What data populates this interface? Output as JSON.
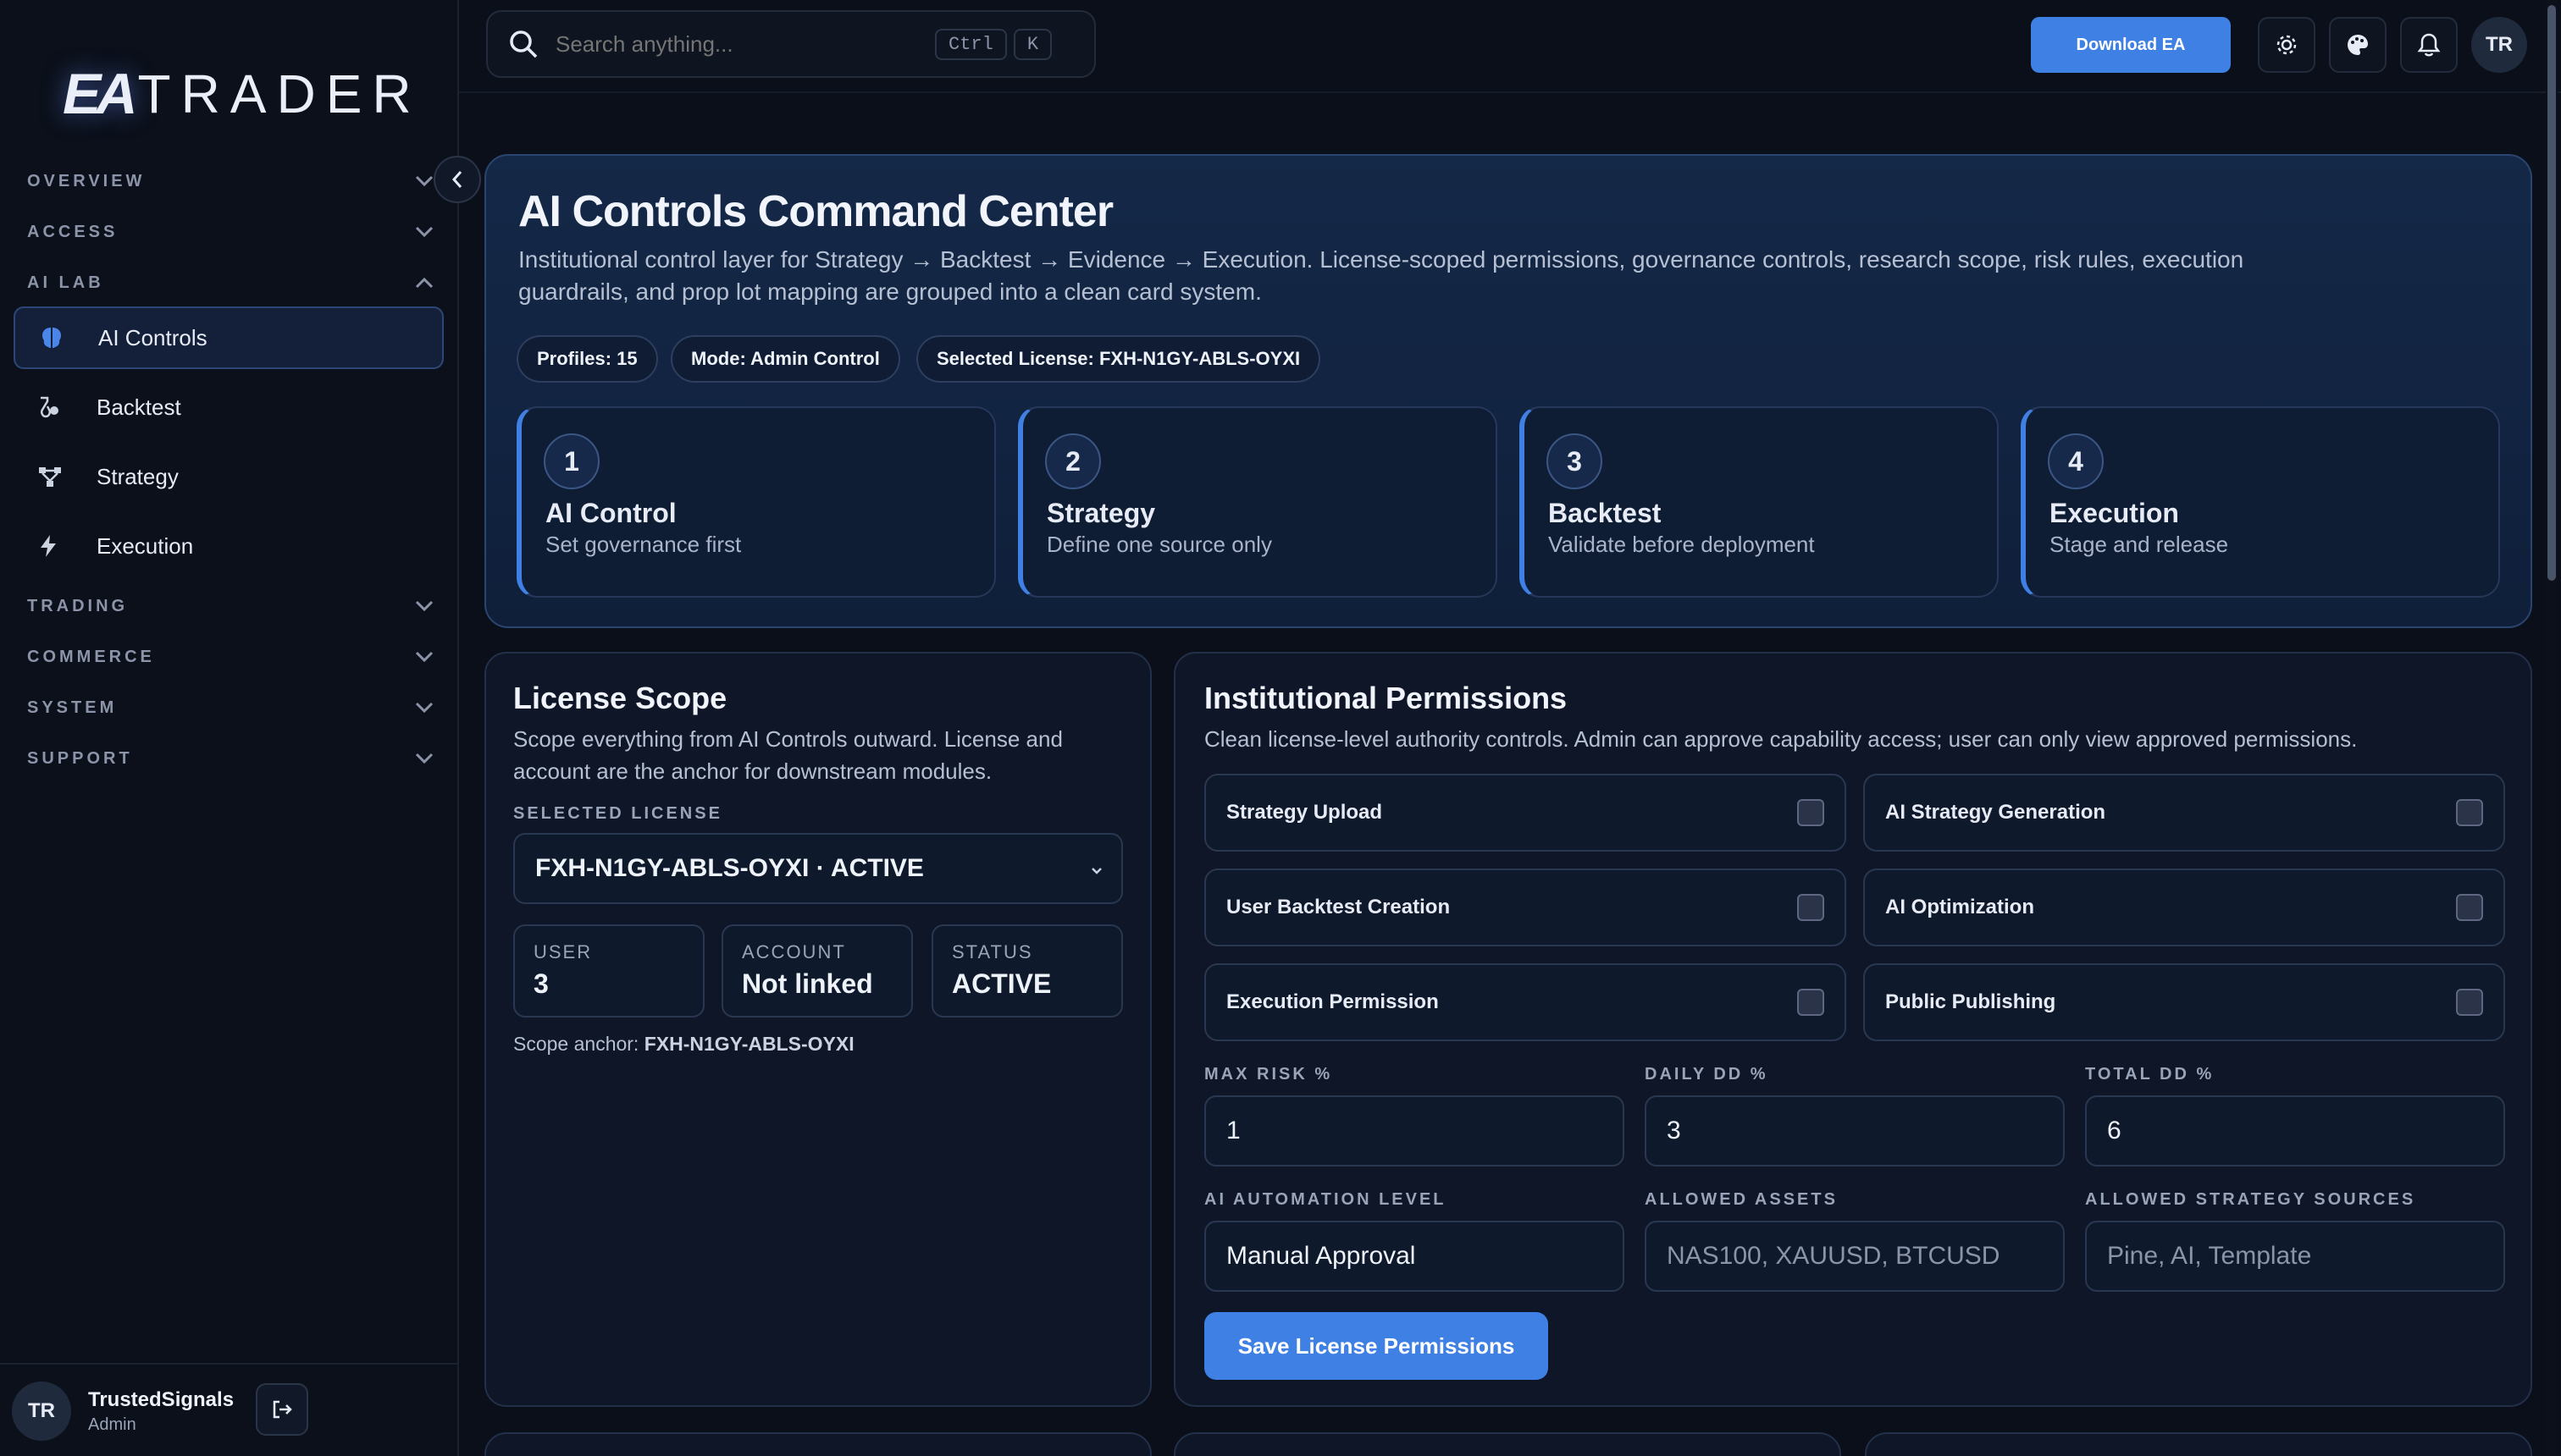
{
  "brand": {
    "mark": "EA",
    "text": "TRADER"
  },
  "sidebar": {
    "sections": [
      {
        "label": "OVERVIEW",
        "state": "collapsed"
      },
      {
        "label": "ACCESS",
        "state": "collapsed"
      },
      {
        "label": "AI LAB",
        "state": "expanded"
      },
      {
        "label": "TRADING",
        "state": "collapsed"
      },
      {
        "label": "COMMERCE",
        "state": "collapsed"
      },
      {
        "label": "SYSTEM",
        "state": "collapsed"
      },
      {
        "label": "SUPPORT",
        "state": "collapsed"
      }
    ],
    "items": [
      {
        "label": "AI Controls",
        "icon": "brain-icon",
        "active": true
      },
      {
        "label": "Backtest",
        "icon": "flask-icon",
        "active": false
      },
      {
        "label": "Strategy",
        "icon": "nodes-icon",
        "active": false
      },
      {
        "label": "Execution",
        "icon": "bolt-icon",
        "active": false
      }
    ],
    "user": {
      "initials": "TR",
      "name": "TrustedSignals",
      "role": "Admin"
    }
  },
  "topbar": {
    "search_placeholder": "Search anything...",
    "shortcut": [
      "Ctrl",
      "K"
    ],
    "download_label": "Download EA",
    "avatar_initials": "TR"
  },
  "hero": {
    "title": "AI Controls Command Center",
    "description": "Institutional control layer for Strategy → Backtest → Evidence → Execution. License-scoped permissions, governance controls, research scope, risk rules, execution guardrails, and prop lot mapping are grouped into a clean card system.",
    "chips": [
      "Profiles: 15",
      "Mode: Admin Control",
      "Selected License: FXH-N1GY-ABLS-OYXI"
    ],
    "steps": [
      {
        "num": "1",
        "title": "AI Control",
        "sub": "Set governance first"
      },
      {
        "num": "2",
        "title": "Strategy",
        "sub": "Define one source only"
      },
      {
        "num": "3",
        "title": "Backtest",
        "sub": "Validate before deployment"
      },
      {
        "num": "4",
        "title": "Execution",
        "sub": "Stage and release"
      }
    ]
  },
  "license": {
    "title": "License Scope",
    "description": "Scope everything from AI Controls outward. License and account are the anchor for downstream modules.",
    "selected_label": "SELECTED LICENSE",
    "selected_value": "FXH-N1GY-ABLS-OYXI · ACTIVE",
    "stats": [
      {
        "key": "USER",
        "value": "3"
      },
      {
        "key": "ACCOUNT",
        "value": "Not linked"
      },
      {
        "key": "STATUS",
        "value": "ACTIVE"
      }
    ],
    "anchor_label": "Scope anchor:",
    "anchor_value": "FXH-N1GY-ABLS-OYXI"
  },
  "permissions": {
    "title": "Institutional Permissions",
    "description": "Clean license-level authority controls. Admin can approve capability access; user can only view approved permissions.",
    "toggles": [
      {
        "label": "Strategy Upload",
        "checked": false
      },
      {
        "label": "AI Strategy Generation",
        "checked": false
      },
      {
        "label": "User Backtest Creation",
        "checked": false
      },
      {
        "label": "AI Optimization",
        "checked": false
      },
      {
        "label": "Execution Permission",
        "checked": false
      },
      {
        "label": "Public Publishing",
        "checked": false
      }
    ],
    "fields": [
      {
        "label": "MAX RISK %",
        "value": "1",
        "placeholder": false
      },
      {
        "label": "DAILY DD %",
        "value": "3",
        "placeholder": false
      },
      {
        "label": "TOTAL DD %",
        "value": "6",
        "placeholder": false
      },
      {
        "label": "AI AUTOMATION LEVEL",
        "value": "Manual Approval",
        "placeholder": false
      },
      {
        "label": "ALLOWED ASSETS",
        "value": "NAS100, XAUUSD, BTCUSD",
        "placeholder": true
      },
      {
        "label": "ALLOWED STRATEGY SOURCES",
        "value": "Pine, AI, Template",
        "placeholder": true
      }
    ],
    "save_label": "Save License Permissions"
  },
  "colors": {
    "accent": "#3f80e4",
    "background": "#0a0f1a",
    "card": "#0e1628",
    "hero": "#132846"
  }
}
